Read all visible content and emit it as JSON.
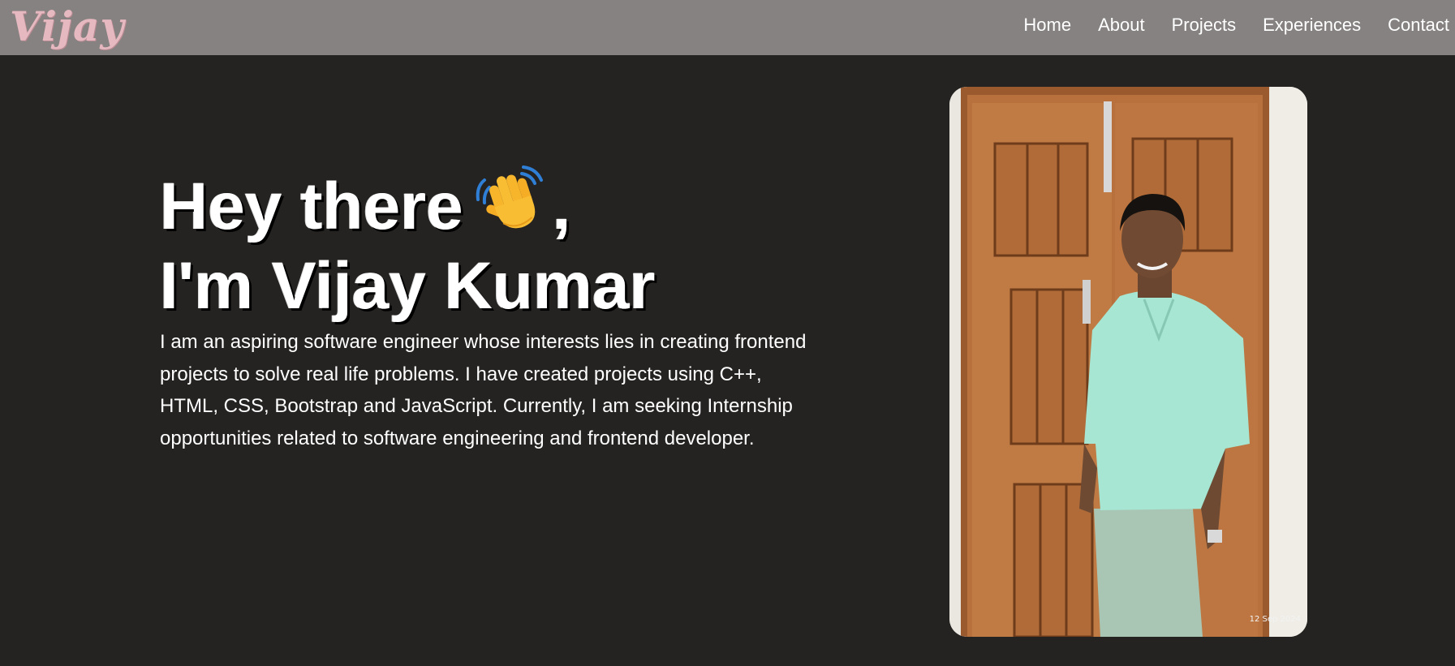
{
  "navbar": {
    "logo": "Vijay",
    "links": [
      "Home",
      "About",
      "Projects",
      "Experiences",
      "Contact"
    ]
  },
  "hero": {
    "greeting": "Hey there",
    "greeting_suffix": ",",
    "name_line": "I'm Vijay Kumar",
    "description": "I am an aspiring software engineer whose interests lies in creating frontend projects to solve real life problems. I have created projects using C++, HTML, CSS, Bootstrap and JavaScript. Currently, I am seeking Internship opportunities related to software engineering and frontend developer.",
    "wave_icon": "waving-hand-icon"
  },
  "profile_photo": {
    "date_stamp": "12 Sep 2024"
  },
  "colors": {
    "page_bg": "#252321",
    "navbar_bg": "#868281",
    "logo": "#e6b9c0",
    "text": "#ffffff"
  }
}
